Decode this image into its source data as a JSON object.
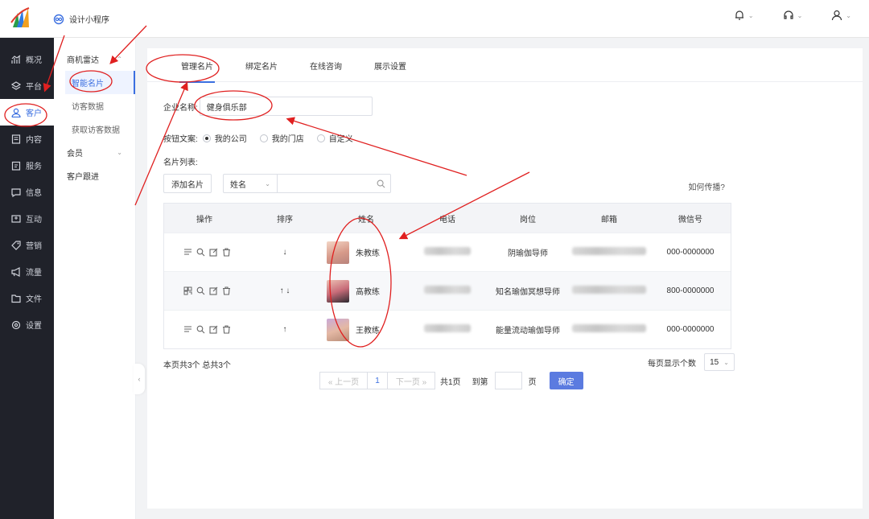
{
  "header": {
    "app_name": "设计小程序"
  },
  "sidebar": {
    "items": [
      {
        "label": "概况"
      },
      {
        "label": "平台"
      },
      {
        "label": "客户"
      },
      {
        "label": "内容"
      },
      {
        "label": "服务"
      },
      {
        "label": "信息"
      },
      {
        "label": "互动"
      },
      {
        "label": "营销"
      },
      {
        "label": "流量"
      },
      {
        "label": "文件"
      },
      {
        "label": "设置"
      }
    ]
  },
  "subnav": {
    "group1": "商机雷达",
    "items": [
      "智能名片",
      "访客数据",
      "获取访客数据"
    ],
    "group2": "会员",
    "group3": "客户跟进"
  },
  "tabs": [
    "管理名片",
    "绑定名片",
    "在线咨询",
    "展示设置"
  ],
  "form": {
    "company_label": "企业名称:",
    "company_value": "健身俱乐部",
    "button_text_label": "按钮文案:",
    "radio_options": [
      "我的公司",
      "我的门店",
      "自定义"
    ],
    "list_label": "名片列表:"
  },
  "toolbar": {
    "add_label": "添加名片",
    "filter_select": "姓名",
    "help_link": "如何传播?"
  },
  "table": {
    "headers": [
      "操作",
      "排序",
      "姓名",
      "电话",
      "岗位",
      "邮箱",
      "微信号"
    ],
    "rows": [
      {
        "sort": "↓",
        "name": "朱教练",
        "position": "阴瑜伽导师",
        "wechat": "000-0000000"
      },
      {
        "sort": "↑ ↓",
        "name": "高教练",
        "position": "知名瑜伽冥想导师",
        "wechat": "800-0000000"
      },
      {
        "sort": "↑",
        "name": "王教练",
        "position": "能量流动瑜伽导师",
        "wechat": "000-0000000"
      }
    ]
  },
  "footer": {
    "summary": "本页共3个  总共3个",
    "page_size_label": "每页显示个数",
    "page_size": "15"
  },
  "pager": {
    "prev": "« 上一页",
    "current": "1",
    "next": "下一页 »",
    "total": "共1页",
    "goto": "到第",
    "page_unit": "页",
    "confirm": "确定"
  },
  "colors": {
    "accent": "#3b6fe0",
    "sidebar_bg": "#20222a",
    "annotation": "#e02020"
  }
}
